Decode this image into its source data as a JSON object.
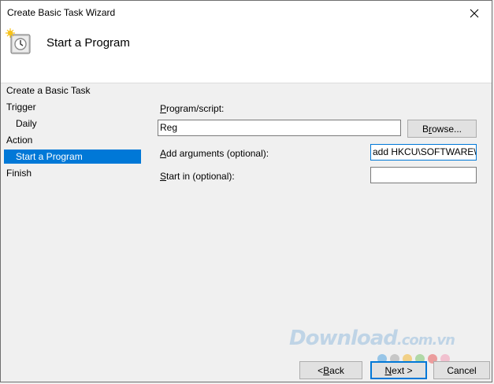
{
  "window": {
    "title": "Create Basic Task Wizard"
  },
  "header": {
    "title": "Start a Program",
    "icon": "task-scheduler-icon"
  },
  "sidebar": {
    "items": [
      {
        "label": "Create a Basic Task"
      },
      {
        "label": "Trigger"
      },
      {
        "label": "Daily"
      },
      {
        "label": "Action"
      },
      {
        "label": "Start a Program",
        "selected": true
      },
      {
        "label": "Finish"
      }
    ]
  },
  "form": {
    "program_label_mnemonic": "P",
    "program_label_rest": "rogram/script:",
    "program_value": "Reg",
    "browse_mnemonic": "r",
    "browse_pre": "B",
    "browse_rest": "owse...",
    "args_label_mnemonic": "A",
    "args_label_rest": "dd arguments (optional):",
    "args_value": "add HKCU\\SOFTWARE\\M",
    "startin_label_mnemonic": "S",
    "startin_label_rest": "tart in (optional):",
    "startin_value": ""
  },
  "buttons": {
    "back_pre": "< ",
    "back_mnemonic": "B",
    "back_rest": "ack",
    "next_mnemonic": "N",
    "next_rest": "ext >",
    "cancel_label": "Cancel"
  },
  "watermark": {
    "text": "Download",
    "suffix": ".com.vn"
  },
  "colors": {
    "selection": "#0078d7",
    "focus_border": "#0078d7"
  }
}
